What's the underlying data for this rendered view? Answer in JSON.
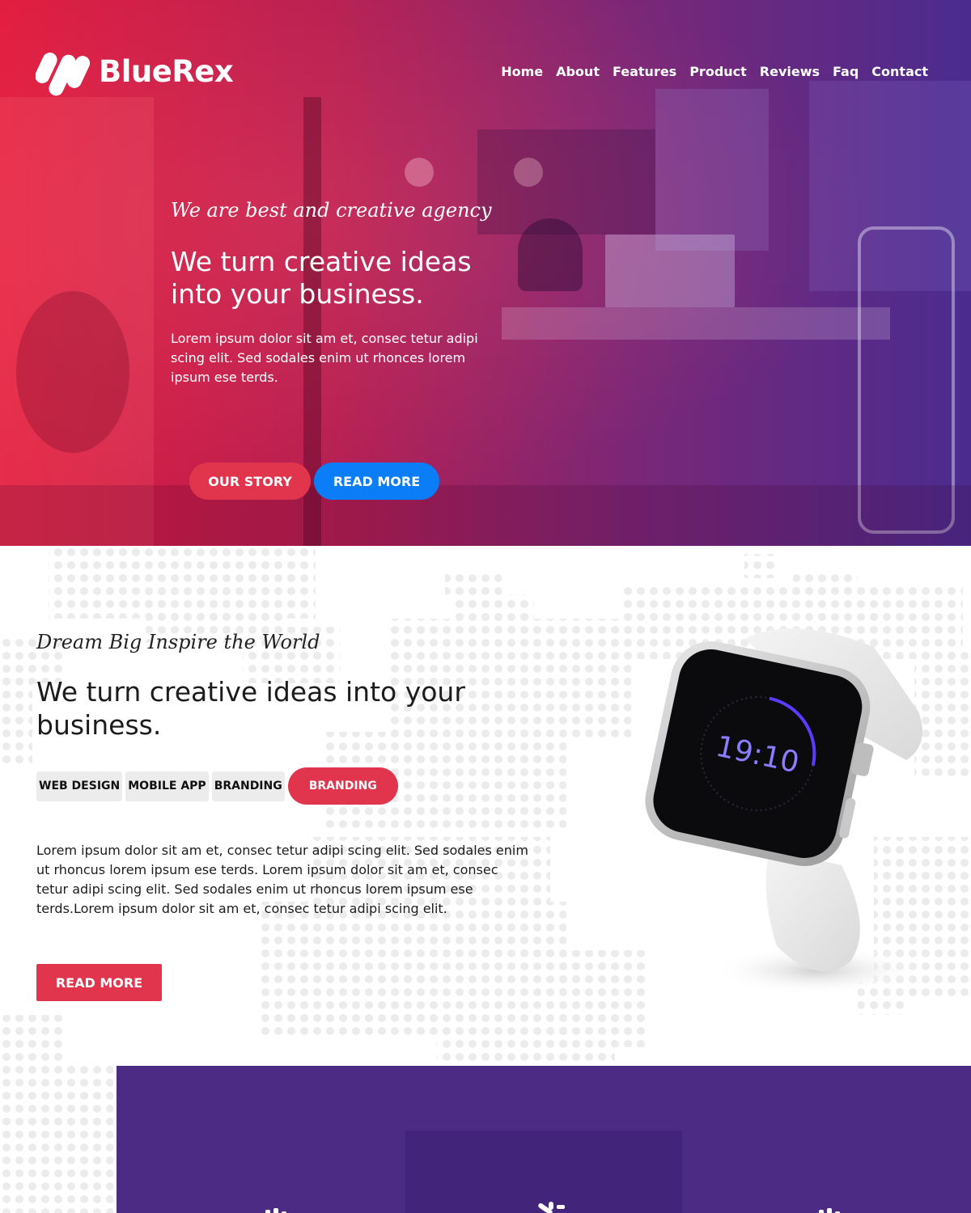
{
  "brand": {
    "name": "BlueRex",
    "logo_icon": "bluerex-stripes-logo"
  },
  "nav": {
    "items": [
      {
        "label": "Home"
      },
      {
        "label": "About"
      },
      {
        "label": "Features"
      },
      {
        "label": "Product"
      },
      {
        "label": "Reviews"
      },
      {
        "label": "Faq"
      },
      {
        "label": "Contact"
      }
    ]
  },
  "hero": {
    "tagline": "We are best and creative agency",
    "title": "We turn creative ideas into your business.",
    "text": "Lorem ipsum dolor sit am et, consec tetur adipi scing elit. Sed sodales enim ut rhonces lorem ipsum ese terds.",
    "buttons": {
      "story": "OUR STORY",
      "read_more": "READ MORE"
    },
    "background": "office-photo-with-red-purple-gradient"
  },
  "about": {
    "tagline": "Dream Big Inspire the World",
    "title": "We turn creative ideas into your business.",
    "chips": [
      {
        "label": "WEB DESIGN"
      },
      {
        "label": "MOBILE APP"
      },
      {
        "label": "BRANDING"
      },
      {
        "label": "BRANDING",
        "active": true
      }
    ],
    "text": "Lorem ipsum dolor sit am et, consec tetur adipi scing elit. Sed sodales enim ut rhoncus lorem ipsum ese terds. Lorem ipsum dolor sit am et, consec tetur adipi scing elit. Sed sodales enim ut rhoncus lorem ipsum ese terds.Lorem ipsum dolor sit am et, consec tetur adipi scing elit.",
    "read_more": "READ MORE",
    "watch": {
      "time": "19:10",
      "image": "smartwatch-icon"
    }
  },
  "features": {
    "icons": [
      "feature-icon",
      "feature-icon",
      "feature-icon"
    ]
  },
  "colors": {
    "accent_red": "#e0354c",
    "accent_blue": "#0a7df7",
    "purple": "#4b2b83"
  }
}
